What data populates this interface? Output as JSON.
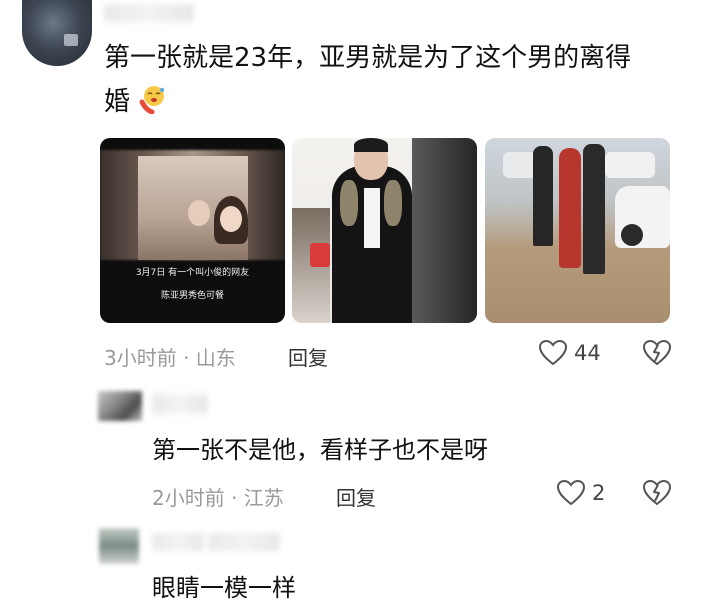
{
  "main_comment": {
    "line1": "第一张就是23年，亚男就是为了这个男的离得",
    "line2": "婚",
    "emoji": "hot-face-icon",
    "images": [
      {
        "caption1": "3月7日 有一个叫小俊的网友",
        "caption2": "陈亚男秀色可餐"
      },
      {},
      {}
    ],
    "meta": "3小时前 · 山东",
    "reply_label": "回复",
    "likes": "44"
  },
  "replies": [
    {
      "text": "第一张不是他，看样子也不是呀",
      "meta": "2小时前 · 江苏",
      "reply_label": "回复",
      "likes": "2"
    },
    {
      "text": "眼睛一模一样"
    }
  ],
  "colors": {
    "meta_gray": "#9a9a9a",
    "text": "#111111"
  }
}
